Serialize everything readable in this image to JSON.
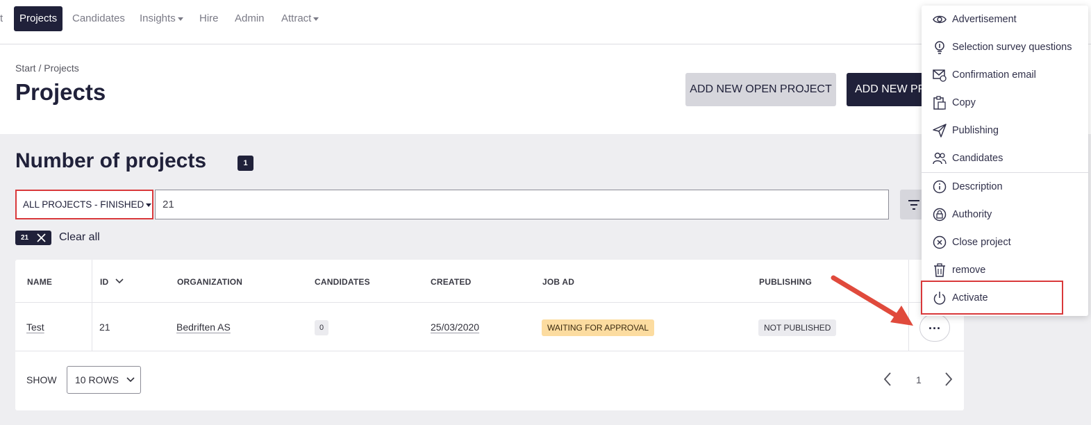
{
  "nav": {
    "items": [
      {
        "label": "t",
        "active": false,
        "caret": false
      },
      {
        "label": "Projects",
        "active": true,
        "caret": false
      },
      {
        "label": "Candidates",
        "active": false,
        "caret": false
      },
      {
        "label": "Insights",
        "active": false,
        "caret": true
      },
      {
        "label": "Hire",
        "active": false,
        "caret": false
      },
      {
        "label": "Admin",
        "active": false,
        "caret": false
      },
      {
        "label": "Attract",
        "active": false,
        "caret": true
      }
    ]
  },
  "breadcrumb": "Start  /  Projects",
  "page_title": "Projects",
  "buttons": {
    "add_open_project": "ADD NEW OPEN PROJECT",
    "add_new_project": "ADD NEW PROJECT"
  },
  "section": {
    "title": "Number of projects",
    "count": "1"
  },
  "filter": {
    "select_value": "ALL PROJECTS - FINISHED",
    "search_value": "21",
    "chip_label": "21",
    "clear_all": "Clear all"
  },
  "table": {
    "headers": {
      "name": "NAME",
      "id": "ID",
      "organization": "ORGANIZATION",
      "candidates": "CANDIDATES",
      "created": "CREATED",
      "job_ad": "JOB AD",
      "publishing": "PUBLISHING"
    },
    "row": {
      "name": "Test",
      "id": "21",
      "organization": "Bedriften AS",
      "candidates": "0",
      "created": "25/03/2020",
      "job_ad": "WAITING FOR APPROVAL",
      "publishing": "NOT PUBLISHED",
      "actions": "..."
    },
    "footer": {
      "show_label": "SHOW",
      "rows_value": "10 ROWS",
      "page": "1"
    }
  },
  "menu": {
    "items": [
      {
        "label": "Advertisement",
        "icon": "eye-icon"
      },
      {
        "label": "Selection survey questions",
        "icon": "lightbulb-icon"
      },
      {
        "label": "Confirmation email",
        "icon": "email-icon"
      },
      {
        "label": "Copy",
        "icon": "clipboard-icon"
      },
      {
        "label": "Publishing",
        "icon": "send-icon"
      },
      {
        "label": "Candidates",
        "icon": "people-icon"
      },
      {
        "label": "Description",
        "icon": "info-icon"
      },
      {
        "label": "Authority",
        "icon": "lock-icon"
      },
      {
        "label": "Close project",
        "icon": "close-circle-icon"
      },
      {
        "label": "remove",
        "icon": "trash-icon"
      },
      {
        "label": "Activate",
        "icon": "power-icon"
      }
    ]
  },
  "colors": {
    "navy": "#20213a",
    "highlight_red": "#d9383a",
    "warning_yellow": "#fcdca0",
    "arrow_red": "#e04a3c"
  }
}
